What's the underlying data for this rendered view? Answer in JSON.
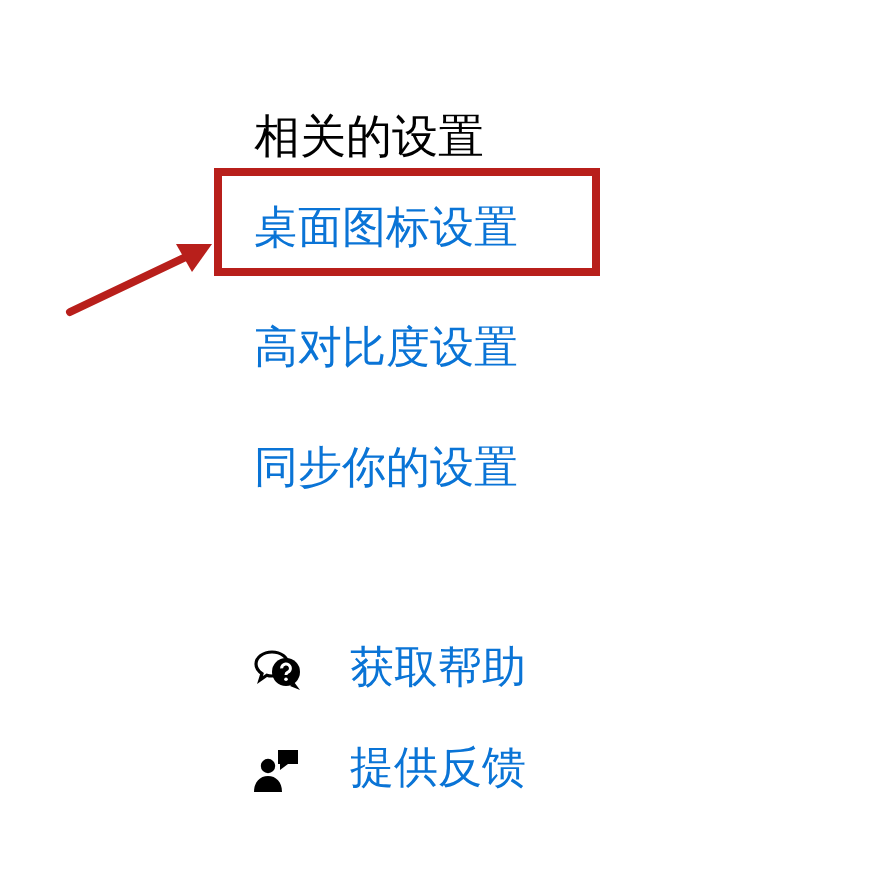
{
  "related_settings": {
    "heading": "相关的设置",
    "links": [
      {
        "label": "桌面图标设置",
        "highlighted": true
      },
      {
        "label": "高对比度设置",
        "highlighted": false
      },
      {
        "label": "同步你的设置",
        "highlighted": false
      }
    ]
  },
  "support": [
    {
      "kind": "help",
      "label": "获取帮助"
    },
    {
      "kind": "feedback",
      "label": "提供反馈"
    }
  ]
}
